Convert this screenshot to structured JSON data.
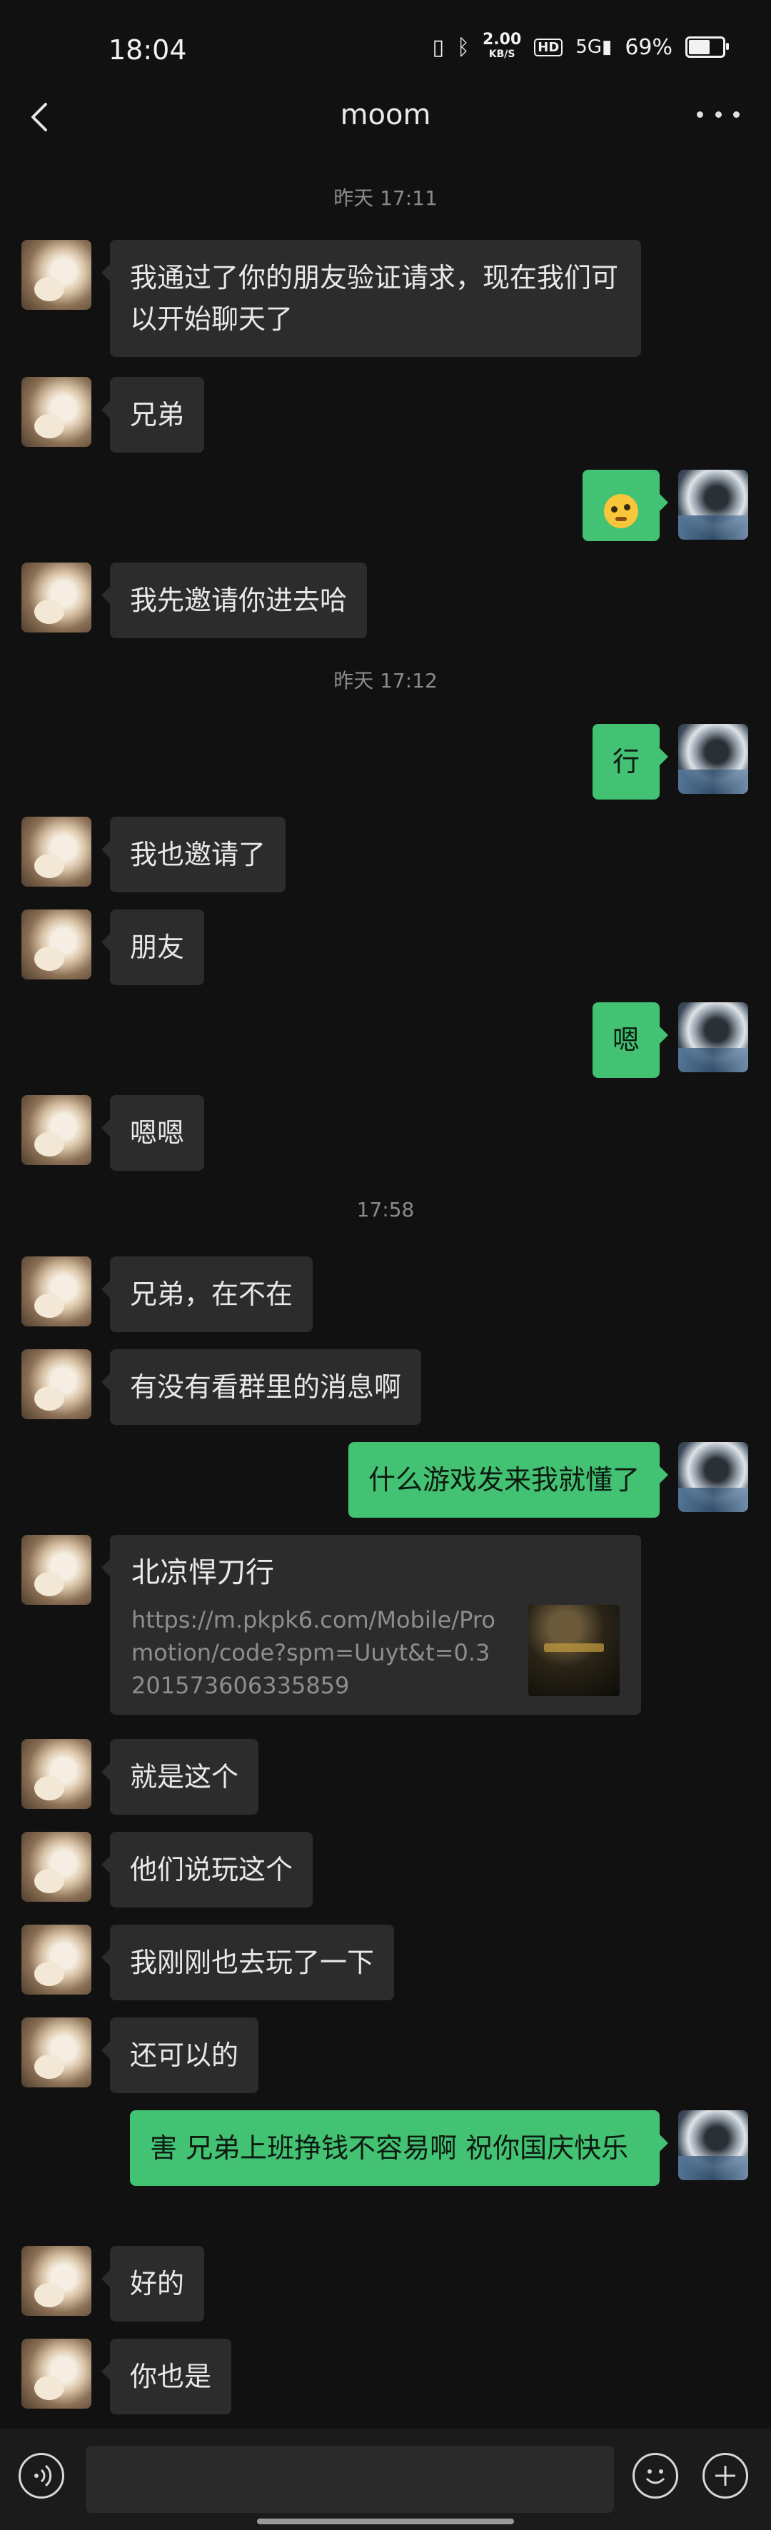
{
  "status": {
    "time": "18:04",
    "speed_value": "2.00",
    "speed_unit": "KB/S",
    "hd": "HD",
    "network": "5G",
    "battery": "69%",
    "battery_level": 0.69
  },
  "header": {
    "title": "moom"
  },
  "timestamps": [
    "昨天 17:11",
    "昨天 17:12",
    "17:58"
  ],
  "messages": [
    {
      "from": "friend",
      "text": "我通过了你的朋友验证请求，现在我们可以开始聊天了"
    },
    {
      "from": "friend",
      "text": "兄弟"
    },
    {
      "from": "me",
      "emoji": "thinking-face-icon"
    },
    {
      "from": "friend",
      "text": "我先邀请你进去哈"
    },
    {
      "from": "me",
      "text": "行"
    },
    {
      "from": "friend",
      "text": "我也邀请了"
    },
    {
      "from": "friend",
      "text": "朋友"
    },
    {
      "from": "me",
      "text": "嗯"
    },
    {
      "from": "friend",
      "text": "嗯嗯"
    },
    {
      "from": "friend",
      "text": "兄弟，在不在"
    },
    {
      "from": "friend",
      "text": "有没有看群里的消息啊"
    },
    {
      "from": "me",
      "text": "什么游戏发来我就懂了"
    },
    {
      "from": "friend",
      "type": "link",
      "title": "北凉悍刀行",
      "url": "https://m.pkpk6.com/Mobile/Promotion/code?spm=Uuyt&t=0.3201573606335859"
    },
    {
      "from": "friend",
      "text": "就是这个"
    },
    {
      "from": "friend",
      "text": "他们说玩这个"
    },
    {
      "from": "friend",
      "text": "我刚刚也去玩了一下"
    },
    {
      "from": "friend",
      "text": "还可以的"
    },
    {
      "from": "me",
      "text": "害 兄弟上班挣钱不容易啊 祝你国庆快乐"
    },
    {
      "from": "friend",
      "text": "好的"
    },
    {
      "from": "friend",
      "text": "你也是"
    }
  ],
  "colors": {
    "background": "#111111",
    "incoming_bubble": "#2c2c2c",
    "outgoing_bubble": "#43c273"
  }
}
